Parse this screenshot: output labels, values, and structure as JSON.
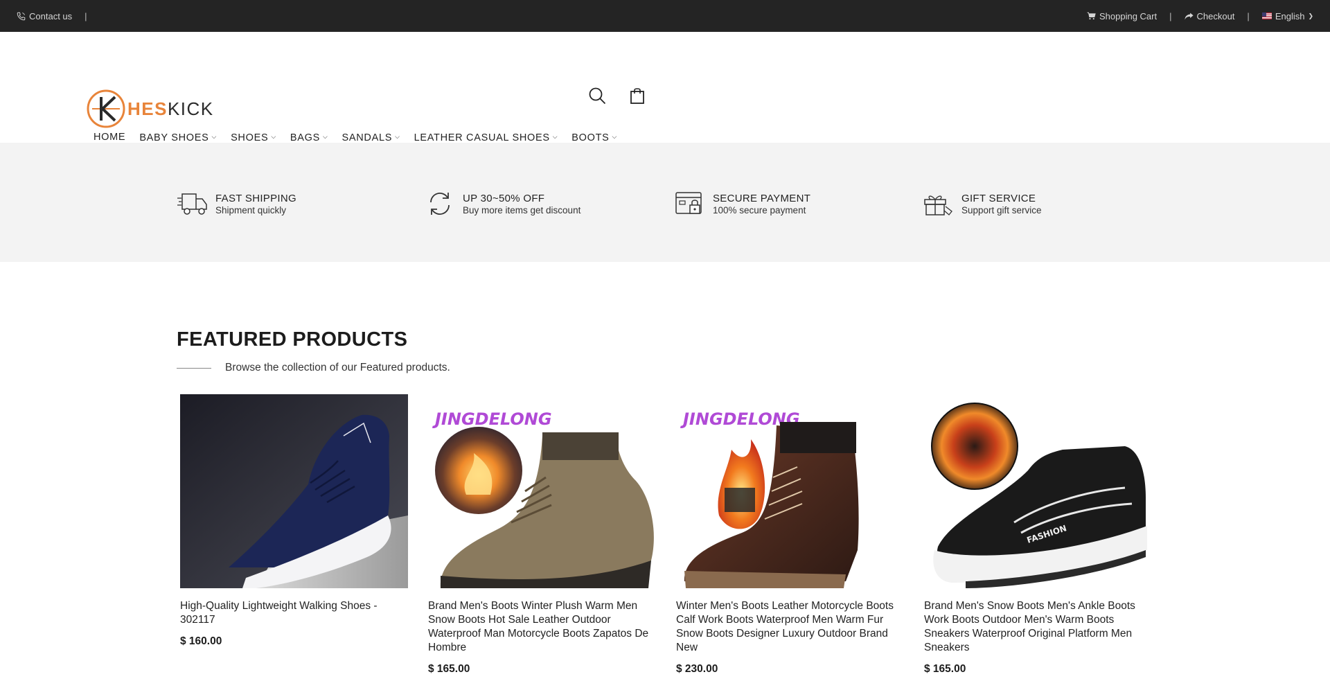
{
  "topbar": {
    "contact_label": "Contact us",
    "cart_label": "Shopping Cart",
    "checkout_label": "Checkout",
    "language_label": "English"
  },
  "brand": {
    "logo_letter": "K",
    "name_accent": "HES",
    "name_rest": "KICK",
    "accent_color": "#e8843a"
  },
  "nav": {
    "items": [
      {
        "label": "HOME",
        "active": true
      },
      {
        "label": "BABY SHOES",
        "dropdown": true
      },
      {
        "label": "SHOES",
        "dropdown": true
      },
      {
        "label": "BAGS",
        "dropdown": true
      },
      {
        "label": "SANDALS",
        "dropdown": true
      },
      {
        "label": "LEATHER CASUAL SHOES",
        "dropdown": true
      },
      {
        "label": "BOOTS",
        "dropdown": true
      }
    ]
  },
  "services": [
    {
      "icon": "truck-icon",
      "title": "FAST SHIPPING",
      "subtitle": "Shipment quickly"
    },
    {
      "icon": "refresh-icon",
      "title": "UP 30~50% OFF",
      "subtitle": "Buy more items get discount"
    },
    {
      "icon": "card-lock-icon",
      "title": "SECURE PAYMENT",
      "subtitle": "100% secure payment"
    },
    {
      "icon": "gift-icon",
      "title": "GIFT SERVICE",
      "subtitle": "Support gift service"
    }
  ],
  "featured": {
    "title": "FEATURED PRODUCTS",
    "subtitle": "Browse the collection of our Featured products.",
    "products": [
      {
        "name": "High-Quality Lightweight Walking Shoes - 302117",
        "price": "$ 160.00"
      },
      {
        "name": "Brand Men's Boots Winter Plush Warm Men Snow Boots Hot Sale Leather Outdoor Waterproof Man Motorcycle Boots Zapatos De Hombre",
        "price": "$ 165.00",
        "badge": "JINGDELONG"
      },
      {
        "name": "Winter Men's Boots Leather Motorcycle Boots Calf Work Boots Waterproof Men Warm Fur Snow Boots Designer Luxury Outdoor Brand New",
        "price": "$ 230.00",
        "badge": "JINGDELONG"
      },
      {
        "name": "Brand Men's Snow Boots Men's Ankle Boots Work Boots Outdoor Men's Warm Boots Sneakers Waterproof Original Platform Men Sneakers",
        "price": "$ 165.00",
        "shoe_text": "FASHION"
      }
    ]
  }
}
